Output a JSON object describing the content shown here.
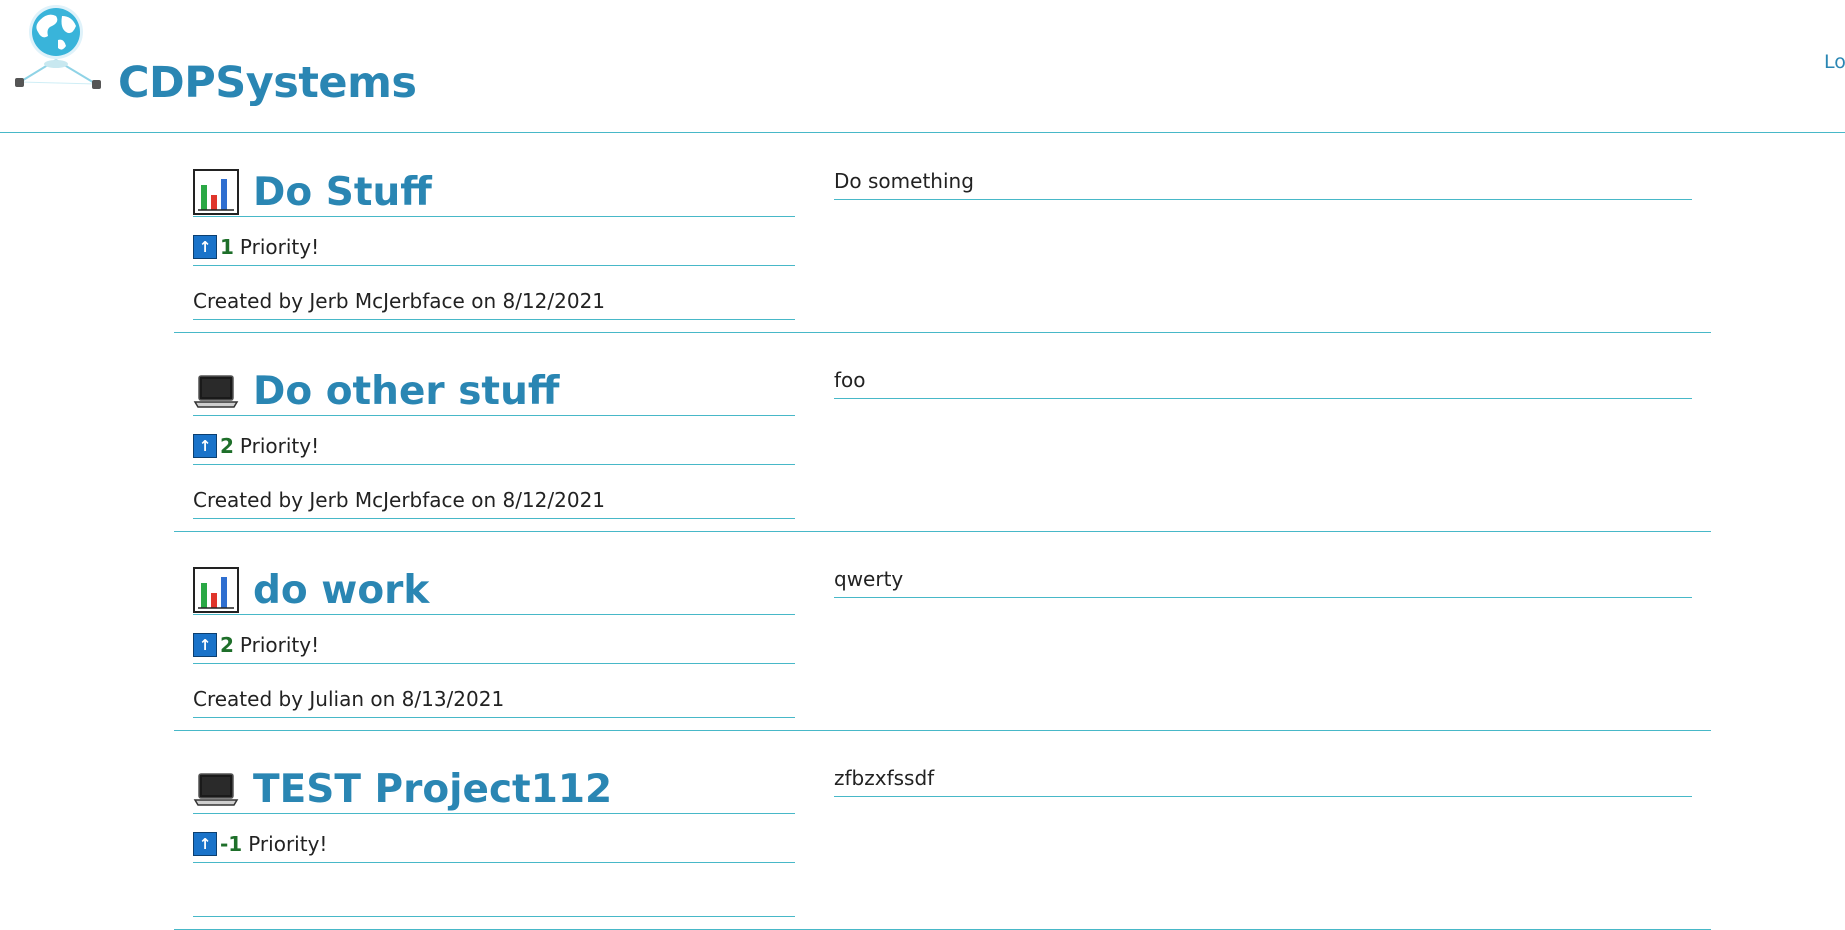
{
  "header": {
    "brand": "CDPSystems",
    "login_label": "Lo"
  },
  "colors": {
    "accent": "#2a86b3",
    "divider": "#48b8c8",
    "priority_number": "#1e6f2a",
    "priority_icon_bg": "#1a73c9"
  },
  "projects": [
    {
      "icon": "bar-chart-icon",
      "title": "Do Stuff",
      "priority_value": "1",
      "priority_label": "Priority!",
      "created": "Created by Jerb McJerbface on 8/12/2021",
      "description": "Do something"
    },
    {
      "icon": "laptop-icon",
      "title": "Do other stuff",
      "priority_value": "2",
      "priority_label": "Priority!",
      "created": "Created by Jerb McJerbface on 8/12/2021",
      "description": "foo"
    },
    {
      "icon": "bar-chart-icon",
      "title": "do work",
      "priority_value": "2",
      "priority_label": "Priority!",
      "created": "Created by Julian on 8/13/2021",
      "description": "qwerty"
    },
    {
      "icon": "laptop-icon",
      "title": "TEST Project112",
      "priority_value": "-1",
      "priority_label": "Priority!",
      "created": "",
      "description": "zfbzxfssdf"
    }
  ]
}
